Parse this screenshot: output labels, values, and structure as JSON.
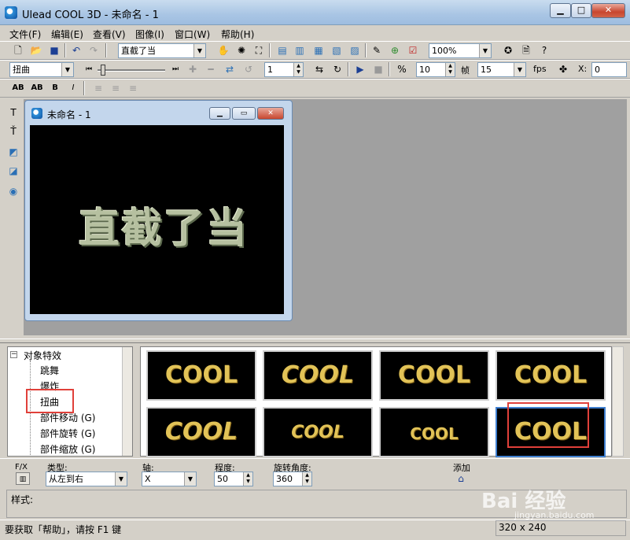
{
  "window": {
    "title": "Ulead COOL 3D - 未命名 - 1"
  },
  "menu": [
    "文件(F)",
    "编辑(E)",
    "查看(V)",
    "图像(I)",
    "窗口(W)",
    "帮助(H)"
  ],
  "toolbar": {
    "text_combo": "直截了当",
    "zoom_combo": "100%"
  },
  "toolbar2": {
    "effect_combo": "扭曲",
    "frame_value": "1",
    "frames_value": "10",
    "frames_label": "帧",
    "fps_value": "15",
    "fps_label": "fps",
    "x_label": "X:",
    "x_value": "0"
  },
  "document": {
    "title": "未命名 - 1",
    "canvas_text": "直截了当"
  },
  "tree": {
    "root": "对象特效",
    "items": [
      "跳舞",
      "爆炸",
      "扭曲",
      "部件移动 (G)",
      "部件旋转 (G)",
      "部件缩放 (G)"
    ]
  },
  "gallery": {
    "thumbnails": [
      "COOL",
      "COOL",
      "COOL",
      "COOL",
      "COOL",
      "COOL",
      "COOL",
      "COOL"
    ]
  },
  "properties": {
    "fx_label": "F/X",
    "type_label": "类型:",
    "type_value": "从左到右",
    "axis_label": "轴:",
    "axis_value": "X",
    "degree_label": "程度:",
    "degree_value": "50",
    "rotation_label": "旋转角度:",
    "rotation_value": "360",
    "add_label": "添加",
    "style_label": "样式:"
  },
  "status": {
    "help_text": "要获取「帮助」，请按 F1 键",
    "canvas_size": "320 x 240"
  },
  "watermark": {
    "text": "Bai 经验",
    "sub": "jingyan.baidu.com"
  },
  "colors": {
    "highlight": "#e0403a",
    "canvas_bg": "#000000",
    "thumb_text": "#e2c357"
  }
}
